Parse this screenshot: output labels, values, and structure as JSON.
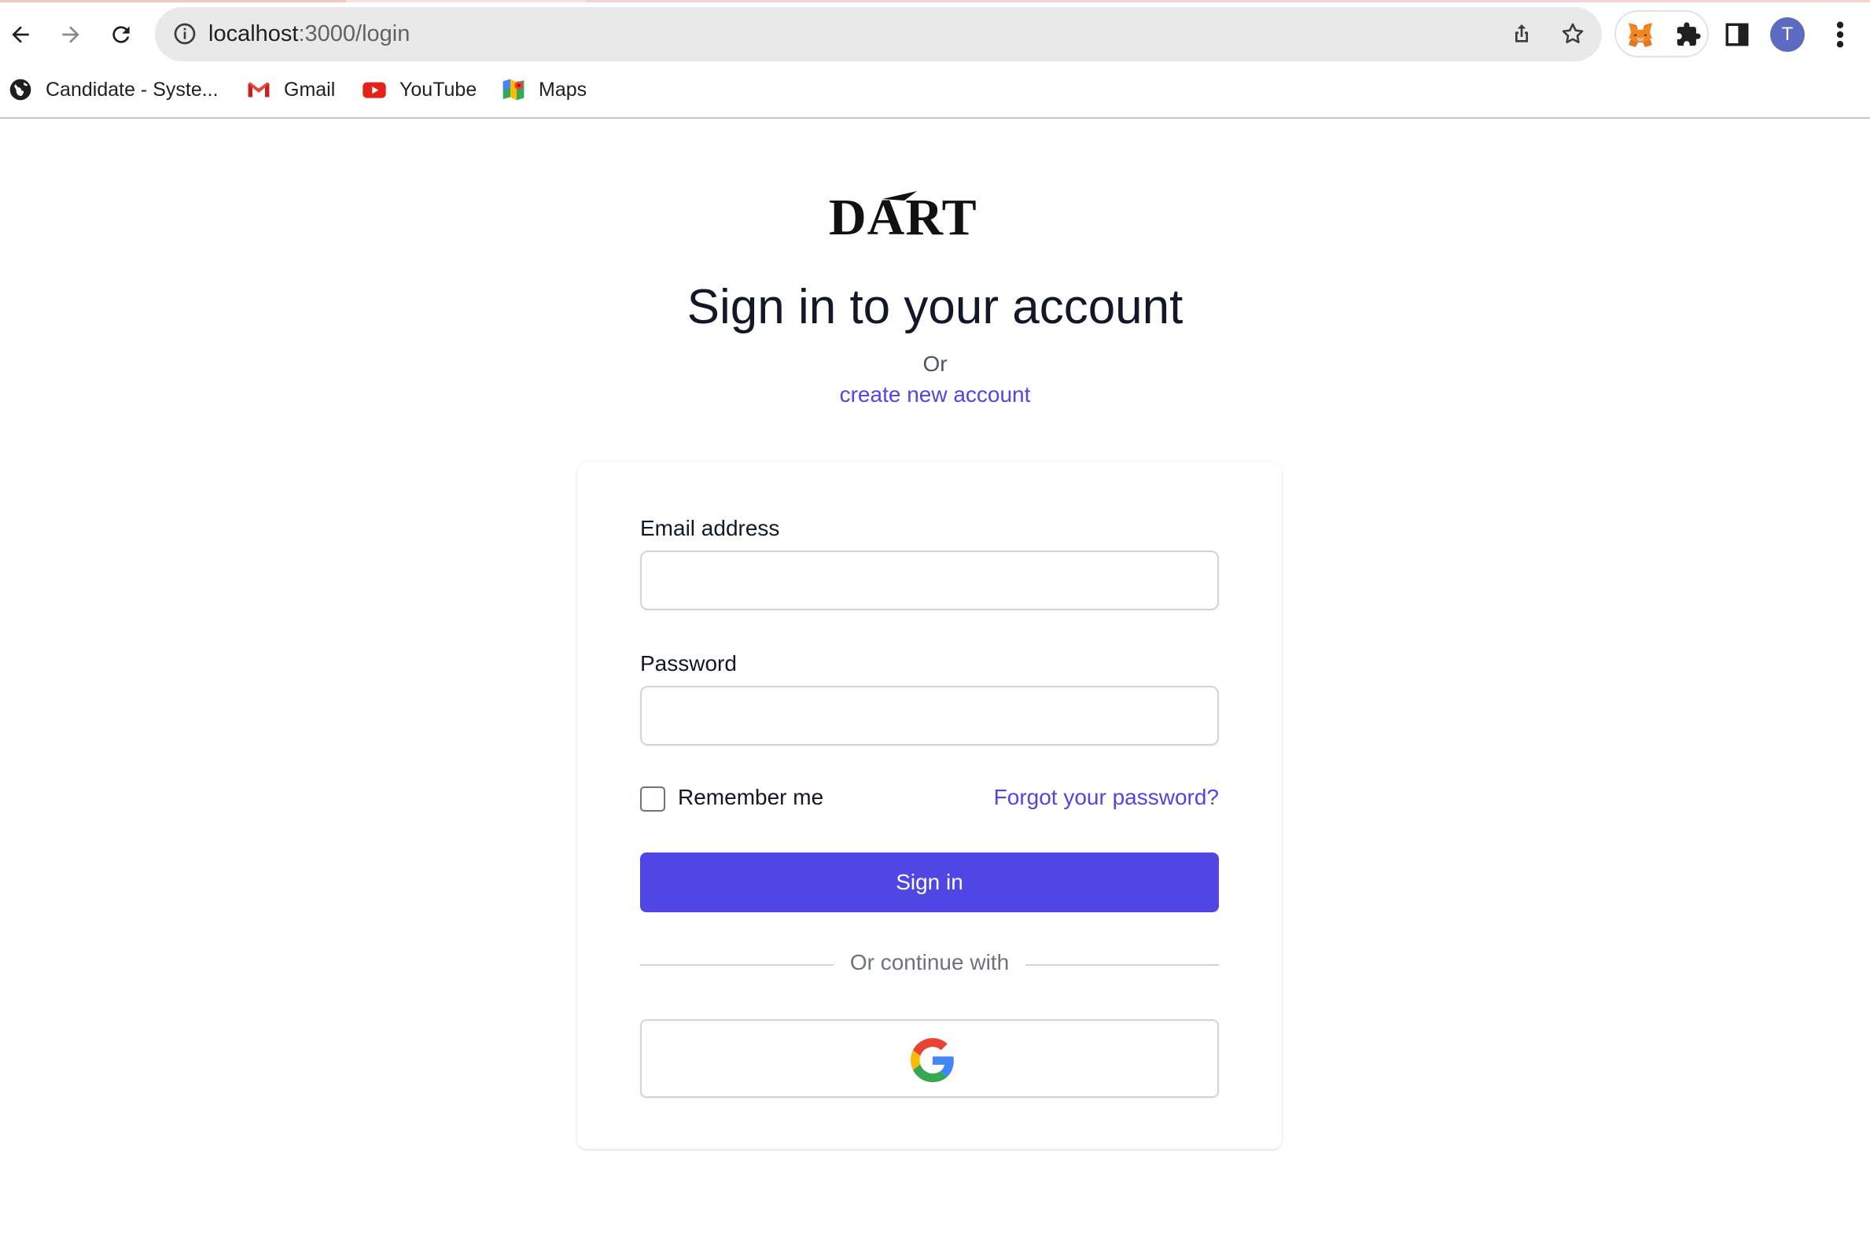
{
  "browser": {
    "url_host": "localhost",
    "url_path": ":3000/login",
    "avatar_initial": "T",
    "bookmarks": [
      {
        "label": "Candidate - Syste...",
        "icon": "globe-icon"
      },
      {
        "label": "Gmail",
        "icon": "gmail-icon"
      },
      {
        "label": "YouTube",
        "icon": "youtube-icon"
      },
      {
        "label": "Maps",
        "icon": "maps-icon"
      }
    ]
  },
  "page": {
    "logo_text": "DART",
    "title": "Sign in to your account",
    "or_text": "Or",
    "create_account_link": "create new account"
  },
  "form": {
    "email_label": "Email address",
    "email_value": "",
    "password_label": "Password",
    "password_value": "",
    "remember_label": "Remember me",
    "remember_checked": false,
    "forgot_link": "Forgot your password?",
    "submit_label": "Sign in",
    "divider_text": "Or continue with",
    "social_provider_icon": "google-icon"
  },
  "colors": {
    "accent": "#4f46e5",
    "text": "#111827",
    "muted": "#6b7280",
    "border": "#d1d5db"
  }
}
